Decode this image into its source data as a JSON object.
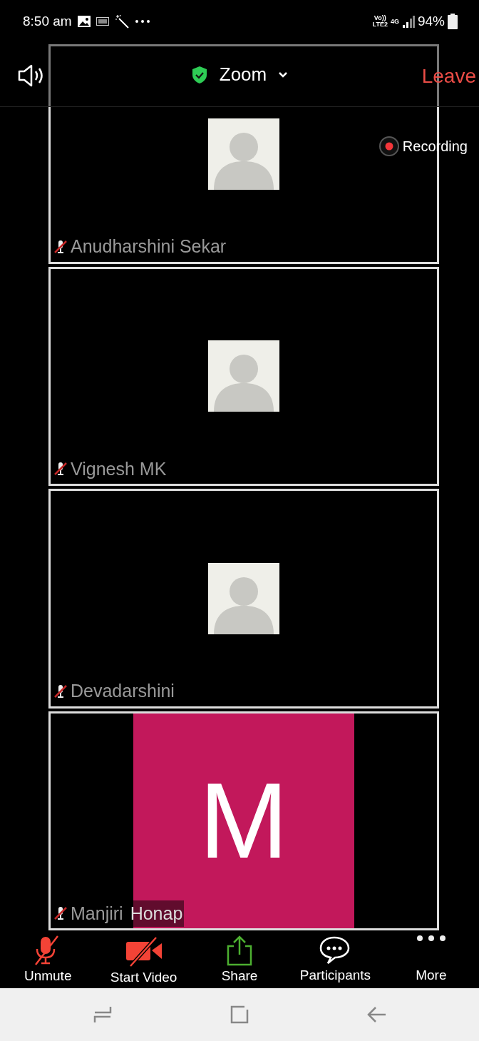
{
  "status_bar": {
    "time": "8:50 am",
    "network_top": "Vo))",
    "network_bottom": "LTE2",
    "network_type": "4G",
    "battery": "94%"
  },
  "meeting_bar": {
    "title": "Zoom",
    "leave": "Leave"
  },
  "recording": {
    "label": "Recording"
  },
  "participants": [
    {
      "name": "Anudharshini Sekar",
      "muted": true,
      "kind": "avatar"
    },
    {
      "name": "Vignesh MK",
      "muted": true,
      "kind": "avatar"
    },
    {
      "name": "Devadarshini",
      "muted": true,
      "kind": "avatar"
    },
    {
      "name": "Manjiri",
      "name_rest": "Honap",
      "muted": true,
      "kind": "initial",
      "initial": "M",
      "color": "#c2185b"
    }
  ],
  "toolbar": [
    {
      "label": "Unmute",
      "kind": "mic",
      "off": true
    },
    {
      "label": "Start Video",
      "kind": "video",
      "off": true
    },
    {
      "label": "Share",
      "kind": "share"
    },
    {
      "label": "Participants",
      "kind": "chat"
    },
    {
      "label": "More",
      "kind": "more"
    }
  ]
}
